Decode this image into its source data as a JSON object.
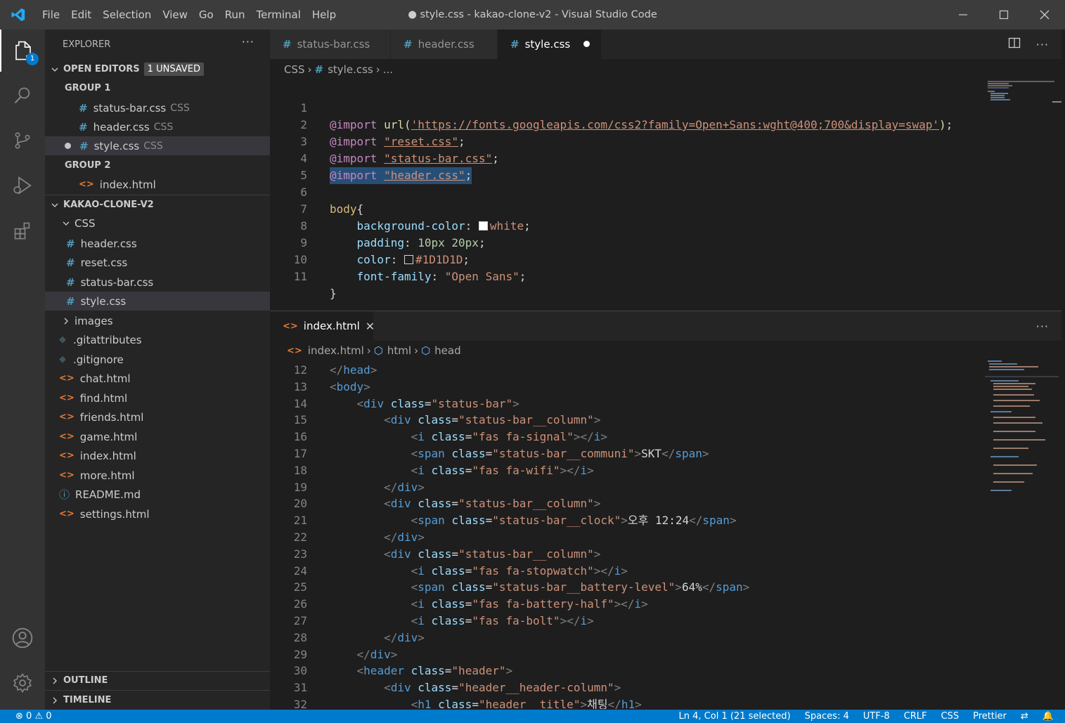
{
  "window": {
    "title": "● style.css - kakao-clone-v2 - Visual Studio Code",
    "menu": [
      "File",
      "Edit",
      "Selection",
      "View",
      "Go",
      "Run",
      "Terminal",
      "Help"
    ]
  },
  "activity": {
    "explorer_badge": "1"
  },
  "explorer": {
    "title": "EXPLORER",
    "more": "···",
    "open_editors": {
      "title": "OPEN EDITORS",
      "badge": "1 UNSAVED",
      "group1_title": "GROUP 1",
      "group2_title": "GROUP 2",
      "group1": [
        {
          "name": "status-bar.css",
          "lang": "CSS"
        },
        {
          "name": "header.css",
          "lang": "CSS"
        },
        {
          "name": "style.css",
          "lang": "CSS"
        }
      ],
      "group2": [
        {
          "name": "index.html"
        }
      ]
    },
    "project": {
      "title": "KAKAO-CLONE-V2",
      "css_folder": "CSS",
      "css_files": [
        "header.css",
        "reset.css",
        "status-bar.css",
        "style.css"
      ],
      "images_folder": "images",
      "files": [
        {
          "name": ".gitattributes",
          "type": "git"
        },
        {
          "name": ".gitignore",
          "type": "git"
        },
        {
          "name": "chat.html",
          "type": "html"
        },
        {
          "name": "find.html",
          "type": "html"
        },
        {
          "name": "friends.html",
          "type": "html"
        },
        {
          "name": "game.html",
          "type": "html"
        },
        {
          "name": "index.html",
          "type": "html"
        },
        {
          "name": "more.html",
          "type": "html"
        },
        {
          "name": "README.md",
          "type": "info"
        },
        {
          "name": "settings.html",
          "type": "html"
        }
      ]
    },
    "outline": "OUTLINE",
    "timeline": "TIMELINE"
  },
  "editor1": {
    "tabs": [
      {
        "name": "status-bar.css"
      },
      {
        "name": "header.css"
      },
      {
        "name": "style.css"
      }
    ],
    "breadcrumb": {
      "folder": "CSS",
      "file": "style.css",
      "rest": "..."
    },
    "line_numbers": [
      "1",
      "2",
      "3",
      "4",
      "5",
      "6",
      "7",
      "8",
      "9",
      "10",
      "11"
    ],
    "lines": {
      "l1_kw": "@import",
      "l1_fn": "url(",
      "l1_str": "'https://fonts.googleapis.com/css2?family=Open+Sans:wght@400;700&display=swap'",
      "l1_end": ");",
      "l2_kw": "@import",
      "l2_str": "\"reset.css\"",
      "l3_kw": "@import",
      "l3_str": "\"status-bar.css\"",
      "l4_kw": "@import",
      "l4_str": "\"header.css\"",
      "l6_sel": "body",
      "l6_brace": "{",
      "l7_prop": "background-color",
      "l7_val": "white",
      "l8_prop": "padding",
      "l8_val": "10px 20px",
      "l9_prop": "color",
      "l9_val": "#1D1D1D",
      "l10_prop": "font-family",
      "l10_val": "\"Open Sans\"",
      "l11_brace": "}"
    },
    "colors": {
      "white_swatch": "#ffffff",
      "dark_swatch": "#1D1D1D"
    }
  },
  "editor2": {
    "tab": "index.html",
    "breadcrumb": {
      "file": "index.html",
      "n1": "html",
      "n2": "head"
    },
    "more": "···",
    "line_numbers": [
      "12",
      "13",
      "14",
      "15",
      "16",
      "17",
      "18",
      "19",
      "20",
      "21",
      "22",
      "23",
      "24",
      "25",
      "26",
      "27",
      "28",
      "29",
      "30",
      "31",
      "32"
    ],
    "code": [
      {
        "indent": 0,
        "open": "</",
        "tag": "head",
        "close": ">"
      },
      {
        "indent": 0,
        "open": "<",
        "tag": "body",
        "close": ">"
      },
      {
        "indent": 1,
        "open": "<",
        "tag": "div",
        "attr": "class",
        "val": "\"status-bar\"",
        "close": ">"
      },
      {
        "indent": 2,
        "open": "<",
        "tag": "div",
        "attr": "class",
        "val": "\"status-bar__column\"",
        "close": ">"
      },
      {
        "indent": 3,
        "open": "<",
        "tag": "i",
        "attr": "class",
        "val": "\"fas fa-signal\"",
        "close": "></",
        "etag": "i",
        "eclose": ">"
      },
      {
        "indent": 3,
        "open": "<",
        "tag": "span",
        "attr": "class",
        "val": "\"status-bar__communi\"",
        "close": ">",
        "text": "SKT",
        "eopen": "</",
        "etag": "span",
        "eclose": ">"
      },
      {
        "indent": 3,
        "open": "<",
        "tag": "i",
        "attr": "class",
        "val": "\"fas fa-wifi\"",
        "close": "></",
        "etag": "i",
        "eclose": ">"
      },
      {
        "indent": 2,
        "open": "</",
        "tag": "div",
        "close": ">"
      },
      {
        "indent": 2,
        "open": "<",
        "tag": "div",
        "attr": "class",
        "val": "\"status-bar__column\"",
        "close": ">"
      },
      {
        "indent": 3,
        "open": "<",
        "tag": "span",
        "attr": "class",
        "val": "\"status-bar__clock\"",
        "close": ">",
        "text": "오후 12:24",
        "eopen": "</",
        "etag": "span",
        "eclose": ">"
      },
      {
        "indent": 2,
        "open": "</",
        "tag": "div",
        "close": ">"
      },
      {
        "indent": 2,
        "open": "<",
        "tag": "div",
        "attr": "class",
        "val": "\"status-bar__column\"",
        "close": ">"
      },
      {
        "indent": 3,
        "open": "<",
        "tag": "i",
        "attr": "class",
        "val": "\"fas fa-stopwatch\"",
        "close": "></",
        "etag": "i",
        "eclose": ">"
      },
      {
        "indent": 3,
        "open": "<",
        "tag": "span",
        "attr": "class",
        "val": "\"status-bar__battery-level\"",
        "close": ">",
        "text": "64%",
        "eopen": "</",
        "etag": "span",
        "eclose": ">"
      },
      {
        "indent": 3,
        "open": "<",
        "tag": "i",
        "attr": "class",
        "val": "\"fas fa-battery-half\"",
        "close": "></",
        "etag": "i",
        "eclose": ">"
      },
      {
        "indent": 3,
        "open": "<",
        "tag": "i",
        "attr": "class",
        "val": "\"fas fa-bolt\"",
        "close": "></",
        "etag": "i",
        "eclose": ">"
      },
      {
        "indent": 2,
        "open": "</",
        "tag": "div",
        "close": ">"
      },
      {
        "indent": 1,
        "open": "</",
        "tag": "div",
        "close": ">"
      },
      {
        "indent": 1,
        "open": "<",
        "tag": "header",
        "attr": "class",
        "val": "\"header\"",
        "close": ">"
      },
      {
        "indent": 2,
        "open": "<",
        "tag": "div",
        "attr": "class",
        "val": "\"header__header-column\"",
        "close": ">"
      },
      {
        "indent": 3,
        "open": "<",
        "tag": "h1",
        "attr": "class",
        "val": "\"header__title\"",
        "close": ">",
        "text": "채팅",
        "eopen": "</",
        "etag": "h1",
        "eclose": ">"
      }
    ]
  },
  "statusbar": {
    "errors": "0",
    "warnings": "0",
    "position": "Ln 4, Col 1 (21 selected)",
    "spaces": "Spaces: 4",
    "encoding": "UTF-8",
    "eol": "CRLF",
    "language": "CSS",
    "formatter": "Prettier"
  }
}
